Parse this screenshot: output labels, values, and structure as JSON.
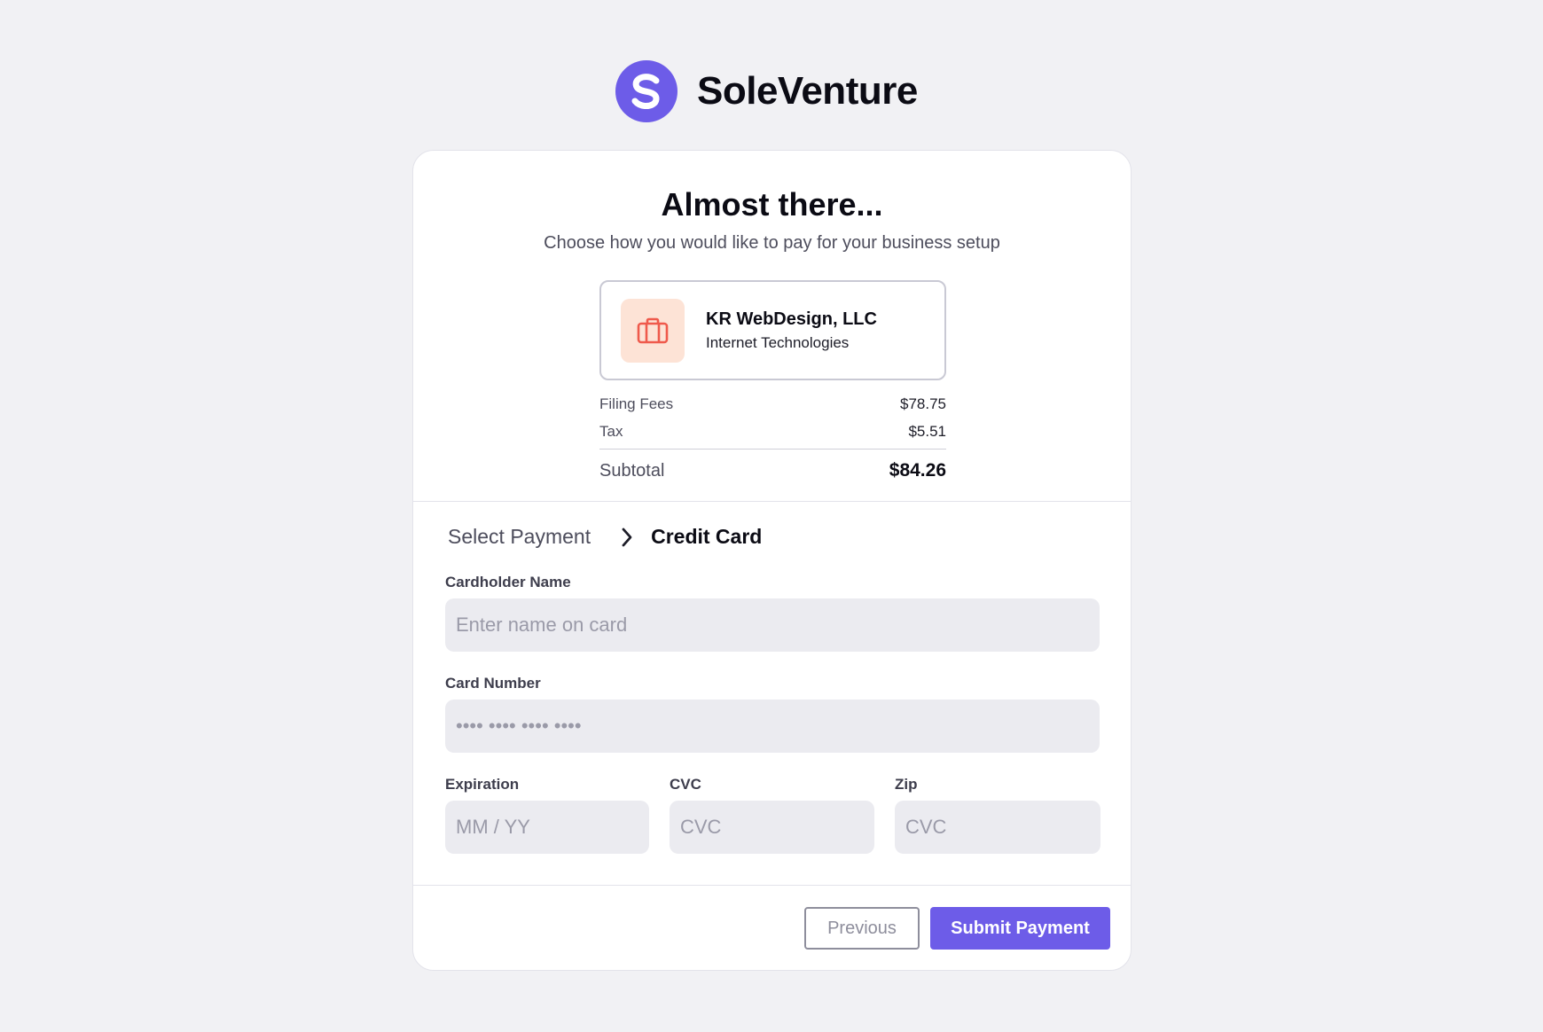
{
  "brand": {
    "name": "SoleVenture",
    "logo_letter": "S",
    "color": "#6d5ce8"
  },
  "header": {
    "title": "Almost there...",
    "subtitle": "Choose how you would like to pay for your business setup"
  },
  "business": {
    "name": "KR WebDesign, LLC",
    "industry": "Internet Technologies",
    "icon": "briefcase-icon"
  },
  "fees": {
    "filing_label": "Filing Fees",
    "filing_amount": "$78.75",
    "tax_label": "Tax",
    "tax_amount": "$5.51",
    "subtotal_label": "Subtotal",
    "subtotal_amount": "$84.26"
  },
  "breadcrumb": {
    "previous": "Select Payment",
    "current": "Credit Card",
    "separator_icon": "chevron-right-icon"
  },
  "form": {
    "cardholder_label": "Cardholder Name",
    "cardholder_placeholder": "Enter name on card",
    "cardholder_value": "",
    "card_number_label": "Card Number",
    "card_number_placeholder": "•••• •••• •••• ••••",
    "card_number_value": "",
    "expiration_label": "Expiration",
    "expiration_placeholder": "MM / YY",
    "expiration_value": "",
    "cvc_label": "CVC",
    "cvc_placeholder": "CVC",
    "cvc_value": "",
    "zip_label": "Zip",
    "zip_placeholder": "CVC",
    "zip_value": ""
  },
  "actions": {
    "previous_label": "Previous",
    "submit_label": "Submit Payment",
    "submit_color": "#6d5ce8"
  }
}
